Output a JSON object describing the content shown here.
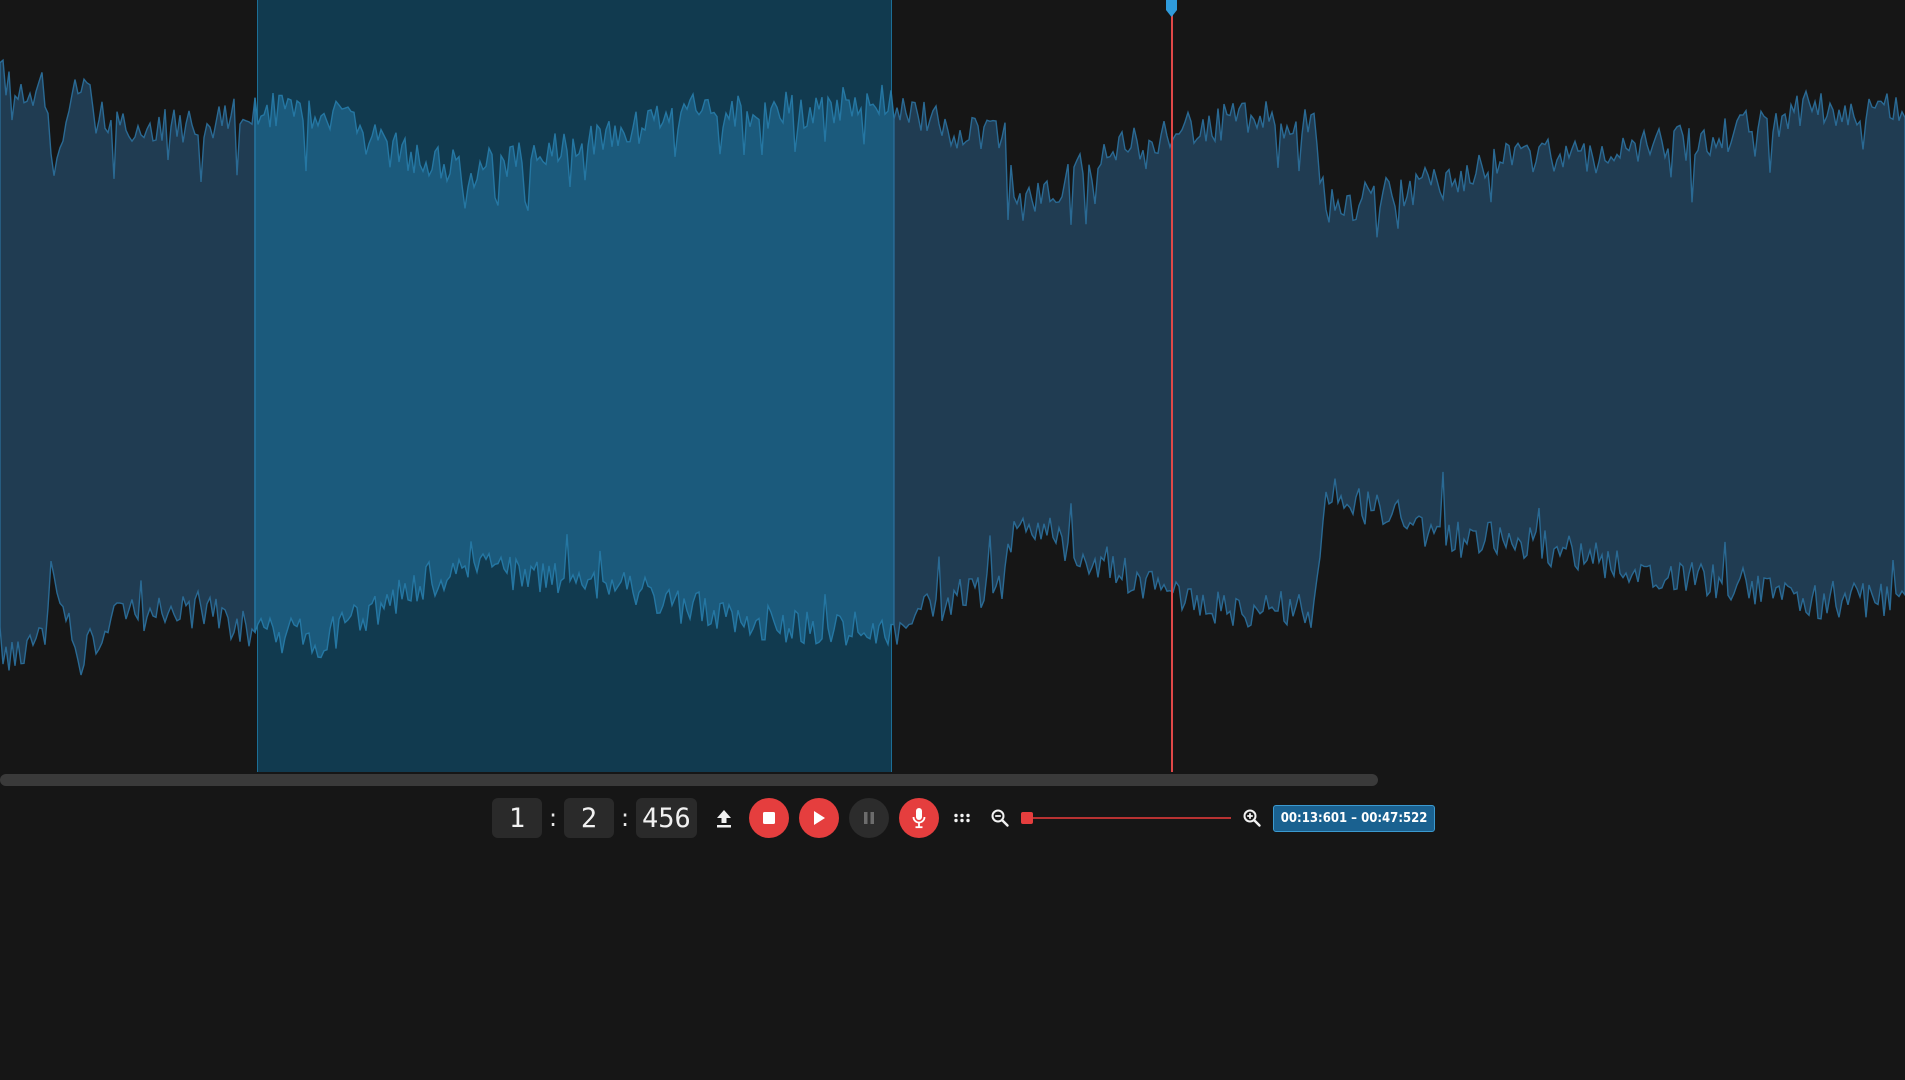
{
  "colors": {
    "background": "#161616",
    "waveform_fill": "#203c52",
    "waveform_edge": "#2a6a94",
    "selection_bg": "#113a4f",
    "selection_wave": "#1b5a7c",
    "playhead": "#e04848",
    "playhead_handle": "#2f9bdc",
    "accent_red": "#e53e3e",
    "badge_bg": "#1a6190"
  },
  "transport": {
    "time": {
      "minutes": "1",
      "seconds": "2",
      "milliseconds": "456",
      "separator": ":"
    },
    "buttons": [
      {
        "name": "upload-button",
        "icon": "upload-icon"
      },
      {
        "name": "stop-button",
        "icon": "stop-icon"
      },
      {
        "name": "play-button",
        "icon": "play-icon"
      },
      {
        "name": "pause-button",
        "icon": "pause-icon"
      },
      {
        "name": "record-button",
        "icon": "microphone-icon"
      },
      {
        "name": "more-button",
        "icon": "dots-grid-icon"
      }
    ]
  },
  "zoom": {
    "out_icon": "zoom-out-icon",
    "in_icon": "zoom-in-icon",
    "level": 0
  },
  "selection": {
    "range_label": "00:13:601 – 00:47:522"
  }
}
